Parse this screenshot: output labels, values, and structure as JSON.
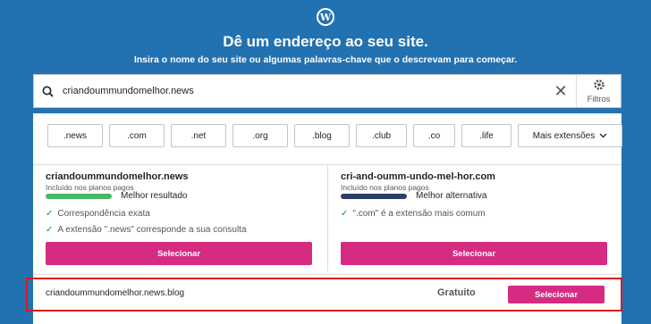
{
  "header": {
    "logo_glyph": "W",
    "title": "Dê um endereço ao seu site.",
    "subtitle": "Insira o nome do seu site ou algumas palavras-chave que o descrevam para começar."
  },
  "search": {
    "value": "criandoummundomelhor.news",
    "clear_glyph": "✕",
    "filters_label": "Filtros"
  },
  "extensions": [
    ".news",
    ".com",
    ".net",
    ".org",
    ".blog",
    ".club",
    ".co",
    ".life"
  ],
  "more_extensions": "Mais extensões",
  "suggestions": [
    {
      "domain": "criandoummundomelhor.news",
      "plan": "Incluído nos planos pagos",
      "rank": "Melhor resultado",
      "bar_color": "#4ab866",
      "features": [
        "Correspondência exata",
        "A extensão \".news\" corresponde a sua consulta"
      ],
      "select_label": "Selecionar"
    },
    {
      "domain": "cri-and-oumm-undo-mel-hor.com",
      "plan": "Incluído nos planos pagos",
      "rank": "Melhor alternativa",
      "bar_color": "#2c3e69",
      "features": [
        "\".com\" é a extensão mais comum"
      ],
      "select_label": "Selecionar"
    }
  ],
  "free": {
    "domain": "criandoummundomelhor.news.blog",
    "price": "Gratuito",
    "select_label": "Selecionar"
  },
  "colors": {
    "background": "#2271b1",
    "accent": "#d52c82",
    "highlight": "#e0141e"
  }
}
